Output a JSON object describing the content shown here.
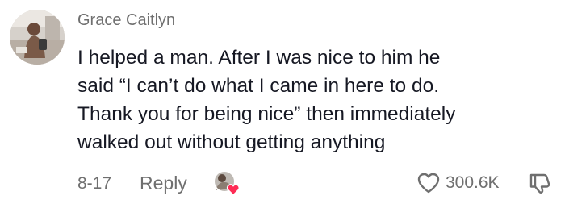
{
  "comment": {
    "username": "Grace Caitlyn",
    "text_lines": [
      "I helped a man. After I was nice to him he",
      "said “I can’t do what I came in here to do.",
      "Thank you for being nice” then immediately",
      "walked out without getting anything"
    ],
    "date": "8-17",
    "reply_label": "Reply",
    "like_count": "300.6K"
  },
  "colors": {
    "text_primary": "#161823",
    "text_secondary": "#6f6f6f",
    "heart_badge": "#fe2c55"
  },
  "icons": {
    "avatar": "avatar-photo",
    "creator_liked": "creator-liked-badge",
    "like": "heart-outline-icon",
    "dislike": "thumbs-down-icon"
  }
}
